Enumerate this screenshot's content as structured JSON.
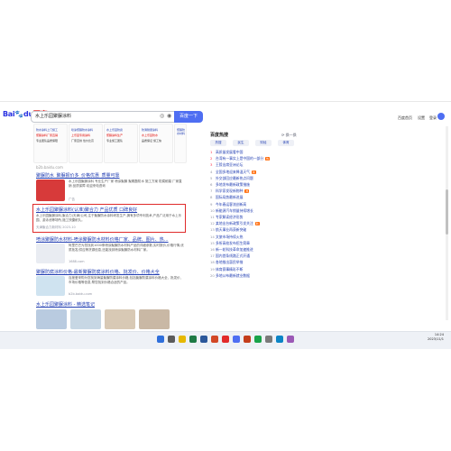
{
  "header": {
    "logo_left": "Bai",
    "logo_paw": "du",
    "logo_right": "百度",
    "query": "水上乐园聚脲涂料",
    "search_button": "百度一下",
    "right_links": [
      "百度首页",
      "设置",
      "登录"
    ]
  },
  "ads": [
    {
      "line1": "防水涂料上门施工",
      "line2": "聚脲涂料厂家直销",
      "line3": "专业团队品质保障"
    },
    {
      "line1": "喷涂聚脲防水涂料",
      "line2": "上乐园专用涂料",
      "line3": "厂家直供 性价比高"
    },
    {
      "line1": "水上乐园防腐",
      "line2": "聚脲涂料生产",
      "line3": "专业施工团队"
    },
    {
      "line1": "防滑耐磨涂料",
      "line2": "水上乐园防水",
      "line3": "品质保证 施工快"
    },
    {
      "line1": "聚脲防水材料",
      "line2": "涂料选购指南",
      "line3": "厂家直销 价格优"
    }
  ],
  "ad_source": "b2b.baidu.com",
  "results": [
    {
      "title": "聚脲防水_聚脲报价多_价格优惠_质量可靠",
      "snippet": "水上乐园聚脲涂料 专业生产厂家 喷涂聚脲 聚氨酯防水 施工方案 防腐耐磨 厂家直销 品质保障 欢迎来电咨询",
      "meta": "广告"
    },
    {
      "title": "水上乐园聚脲涂料(认准)聚合力 产品优质 口碑良好",
      "snippet": "水上乐园聚脲涂料,聚合力(天津)公司,注于聚脲防水涂料研发生产,拥有多项专利技术,产品广泛用于水上乐园、游泳池等场所,施工快捷耐久。",
      "meta": "天津聚合力新材料 2023-10"
    },
    {
      "title": "喷涂聚脲防水材料-喷涂聚脲防水材料价格厂家、品牌、图片、热...",
      "snippet": "阿里巴巴为您找到1000条喷涂聚脲防水材料产品的详细参数,实时报价,价格行情,优质批发/供应等货源信息,还能找到喷涂聚脲防水材料厂家。",
      "meta": "1688.com"
    },
    {
      "title": "聚脲防腐涂料价格-最新聚脲防腐涂料价格、批发价、价格大全",
      "snippet": "百度爱采购为您找到海量聚脲防腐涂料价格,包括聚脲防腐涂料价格大全、批发价、市场价格等信息,帮您找到价格合适的产品。",
      "meta": "b2b.baidu.com"
    }
  ],
  "images_section_title": "水上乐园聚脲涂料 - 精选笔记",
  "hotlist": {
    "title": "百度热搜",
    "refresh": "换一换",
    "tabs": [
      "热搜",
      "民生",
      "财经",
      "体育"
    ],
    "items": [
      {
        "num": "1",
        "text": "高质量发展看中国",
        "badge": ""
      },
      {
        "num": "2",
        "text": "台湾有一事实上是中国的一部分",
        "badge": "热"
      },
      {
        "num": "3",
        "text": "王毅出席亚洲论坛",
        "badge": ""
      },
      {
        "num": "4",
        "text": "全国多地迎来降温天气",
        "badge": "新"
      },
      {
        "num": "5",
        "text": "外交部回应最新热点问题",
        "badge": ""
      },
      {
        "num": "6",
        "text": "多地发布最新政策措施",
        "badge": ""
      },
      {
        "num": "7",
        "text": "科学家发现新物种",
        "badge": "热"
      },
      {
        "num": "8",
        "text": "国际局势最新进展",
        "badge": ""
      },
      {
        "num": "9",
        "text": "今年春运客流创新高",
        "badge": ""
      },
      {
        "num": "10",
        "text": "新能源汽车销量持续增长",
        "badge": ""
      },
      {
        "num": "11",
        "text": "专家解读经济形势",
        "badge": ""
      },
      {
        "num": "12",
        "text": "某地出台新政策引发关注",
        "badge": "新"
      },
      {
        "num": "13",
        "text": "航天事业再获新突破",
        "badge": ""
      },
      {
        "num": "14",
        "text": "文旅市场持续火热",
        "badge": ""
      },
      {
        "num": "15",
        "text": "多所高校发布招生简章",
        "badge": ""
      },
      {
        "num": "16",
        "text": "新一轮科技革命加速推进",
        "badge": ""
      },
      {
        "num": "17",
        "text": "国内首条线路正式开通",
        "badge": ""
      },
      {
        "num": "18",
        "text": "各地推出惠民举措",
        "badge": ""
      },
      {
        "num": "19",
        "text": "体育赛事精彩不断",
        "badge": ""
      },
      {
        "num": "20",
        "text": "多地公布最新就业数据",
        "badge": ""
      }
    ]
  },
  "taskbar": {
    "time": "14:24",
    "date": "2023/11/1"
  },
  "colors": {
    "link": "#2440b3",
    "brand": "#4e6ef2",
    "highlight": "#e02b2b"
  }
}
